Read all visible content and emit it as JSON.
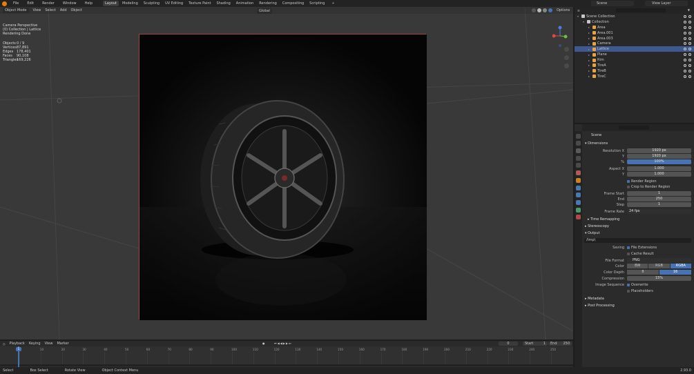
{
  "topbar": {
    "menus": [
      "File",
      "Edit",
      "Render",
      "Window",
      "Help"
    ],
    "workspaces": [
      "Layout",
      "Modeling",
      "Sculpting",
      "UV Editing",
      "Texture Paint",
      "Shading",
      "Animation",
      "Rendering",
      "Compositing",
      "Scripting"
    ],
    "active_workspace": "Layout",
    "add_tab": "+",
    "scene": "Scene",
    "view_layer": "View Layer"
  },
  "viewport": {
    "mode": "Object Mode",
    "menus": [
      "View",
      "Select",
      "Add",
      "Object"
    ],
    "transform_orientation": "Global",
    "options": "Options",
    "info": [
      "Camera Perspective",
      "(0) Collection | Lattice",
      "Rendering Done"
    ],
    "stats": [
      [
        "Objects",
        "0 / 9"
      ],
      [
        "Vertices",
        "87,891"
      ],
      [
        "Edges",
        "178,401"
      ],
      [
        "Faces",
        "90,108"
      ],
      [
        "Triangles",
        "169,226"
      ]
    ],
    "gizmo": {
      "x": "X",
      "y": "Y",
      "z": "Z"
    }
  },
  "outliner": {
    "rows": [
      {
        "label": "Scene Collection",
        "indent": 0,
        "icon": "scene-collection-icon",
        "color": "#c8c8c8",
        "sel": false
      },
      {
        "label": "Collection",
        "indent": 1,
        "icon": "collection-icon",
        "color": "#c8c8c8",
        "sel": false
      },
      {
        "label": "Area",
        "indent": 2,
        "icon": "light-icon",
        "color": "#e8a440",
        "sel": false
      },
      {
        "label": "Area.001",
        "indent": 2,
        "icon": "light-icon",
        "color": "#e8a440",
        "sel": false
      },
      {
        "label": "Area.003",
        "indent": 2,
        "icon": "light-icon",
        "color": "#e8a440",
        "sel": false
      },
      {
        "label": "Camera",
        "indent": 2,
        "icon": "camera-icon",
        "color": "#e8a440",
        "sel": false
      },
      {
        "label": "Lattice",
        "indent": 2,
        "icon": "lattice-icon",
        "color": "#e8a440",
        "sel": true
      },
      {
        "label": "Plane",
        "indent": 2,
        "icon": "mesh-icon",
        "color": "#e8a440",
        "sel": false
      },
      {
        "label": "Rim",
        "indent": 2,
        "icon": "mesh-icon",
        "color": "#e8a440",
        "sel": false
      },
      {
        "label": "TireA",
        "indent": 2,
        "icon": "mesh-icon",
        "color": "#e8a440",
        "sel": false
      },
      {
        "label": "TireB",
        "indent": 2,
        "icon": "mesh-icon",
        "color": "#e8a440",
        "sel": false
      },
      {
        "label": "TireC",
        "indent": 2,
        "icon": "mesh-icon",
        "color": "#e8a440",
        "sel": false
      }
    ]
  },
  "properties": {
    "scene": "Scene",
    "dimensions": "Dimensions",
    "res_x_label": "Resolution X",
    "res_x": "1920 px",
    "res_y_label": "Y",
    "res_y": "1920 px",
    "pct_label": "%",
    "pct": "100%",
    "aspect_x_label": "Aspect X",
    "aspect_x": "1.000",
    "aspect_y_label": "Y",
    "aspect_y": "1.000",
    "render_region": "Render Region",
    "crop_region": "Crop to Render Region",
    "frame_start_label": "Frame Start",
    "frame_start": "1",
    "end_label": "End",
    "end": "250",
    "step_label": "Step",
    "step": "1",
    "frame_rate_label": "Frame Rate",
    "frame_rate": "24 fps",
    "time_remapping": "Time Remapping",
    "stereoscopy": "Stereoscopy",
    "output": "Output",
    "output_path": "/tmp\\",
    "saving_label": "Saving",
    "file_ext": "File Extensions",
    "cache_result": "Cache Result",
    "file_format_label": "File Format",
    "file_format": "PNG",
    "color_label": "Color",
    "color_opts": [
      "BW",
      "RGB",
      "RGBA"
    ],
    "color_sel": "RGBA",
    "depth_label": "Color Depth",
    "depth_opts": [
      "8",
      "16"
    ],
    "depth_sel": "16",
    "compression_label": "Compression",
    "compression": "15%",
    "image_seq_label": "Image Sequence",
    "overwrite": "Overwrite",
    "placeholders": "Placeholders",
    "metadata": "Metadata",
    "post_processing": "Post Processing"
  },
  "timeline": {
    "menus": [
      "Playback",
      "Keying",
      "View",
      "Marker"
    ],
    "current_frame": "0",
    "start_label": "Start",
    "start": "1",
    "end_label": "End",
    "end": "250",
    "playhead": "1",
    "ticks": [
      "0",
      "10",
      "20",
      "30",
      "40",
      "50",
      "60",
      "70",
      "80",
      "90",
      "100",
      "110",
      "120",
      "130",
      "140",
      "150",
      "160",
      "170",
      "180",
      "190",
      "200",
      "210",
      "220",
      "230",
      "240",
      "250"
    ]
  },
  "status": {
    "items": [
      "Select",
      "Box Select",
      "Rotate View",
      "Object Context Menu"
    ],
    "version": "2.93.0"
  }
}
